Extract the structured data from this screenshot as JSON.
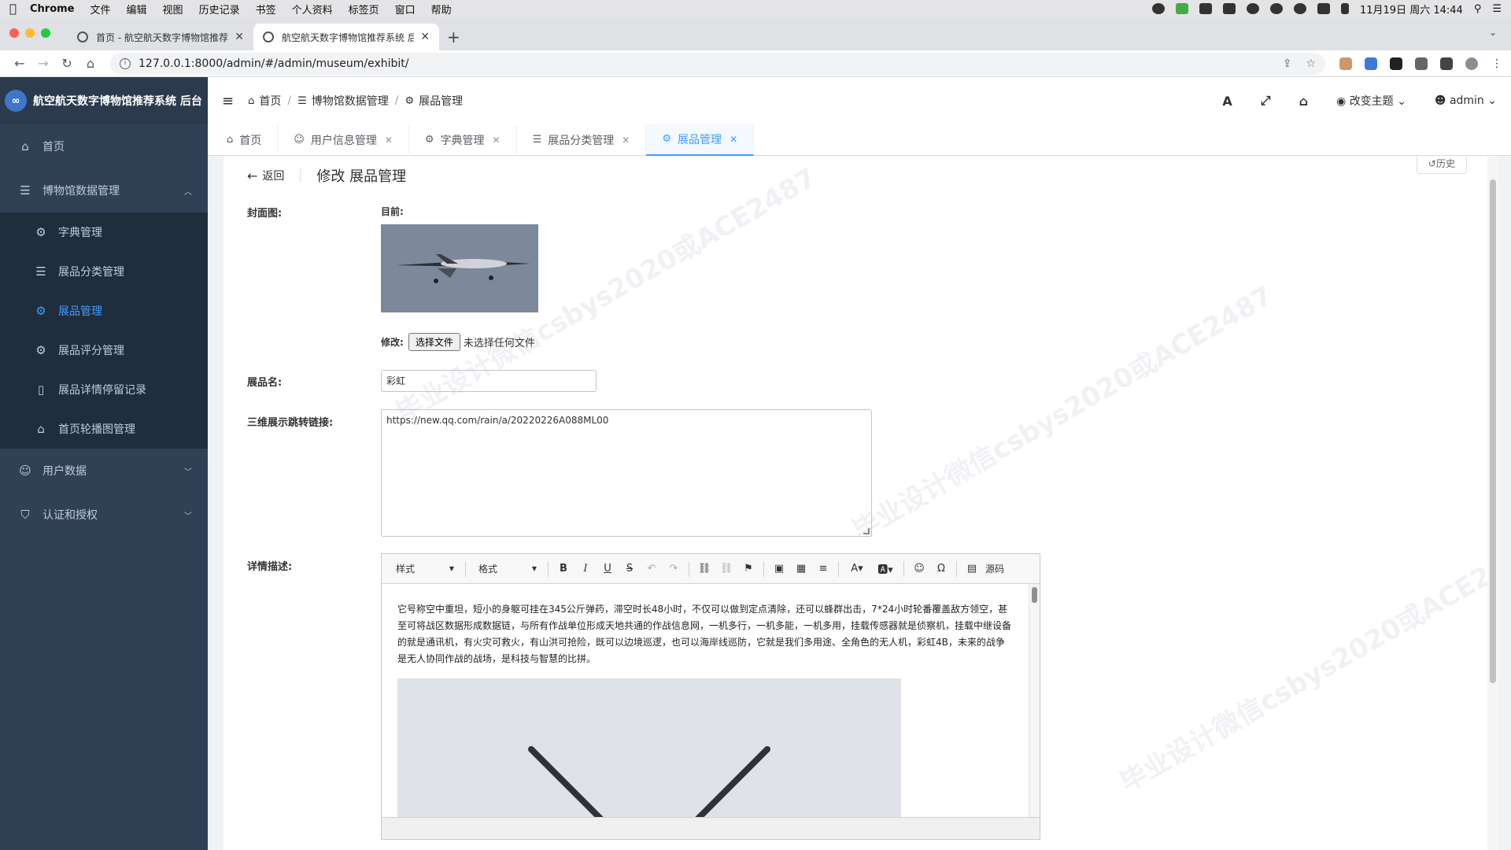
{
  "mac_menu": {
    "app": "Chrome",
    "items": [
      "文件",
      "编辑",
      "视图",
      "历史记录",
      "书签",
      "个人资料",
      "标签页",
      "窗口",
      "帮助"
    ],
    "clock": "11月19日 周六 14:44"
  },
  "browser": {
    "tabs": [
      {
        "title": "首页 - 航空航天数字博物馆推荐系"
      },
      {
        "title": "航空航天数字博物馆推荐系统 后"
      }
    ],
    "url": "127.0.0.1:8000/admin/#/admin/museum/exhibit/"
  },
  "sidebar": {
    "brand": "航空航天数字博物馆推荐系统 后台",
    "logo_glyph": "∞",
    "items": [
      {
        "label": "首页",
        "icon": "home-icon"
      },
      {
        "label": "博物馆数据管理",
        "icon": "database-icon",
        "expanded": true,
        "children": [
          {
            "label": "字典管理",
            "icon": "gear-icon"
          },
          {
            "label": "展品分类管理",
            "icon": "list-icon"
          },
          {
            "label": "展品管理",
            "icon": "gear-icon",
            "active": true
          },
          {
            "label": "展品评分管理",
            "icon": "gear-icon"
          },
          {
            "label": "展品详情停留记录",
            "icon": "bookmark-icon"
          },
          {
            "label": "首页轮播图管理",
            "icon": "home-icon"
          }
        ]
      },
      {
        "label": "用户数据",
        "icon": "user-icon"
      },
      {
        "label": "认证和授权",
        "icon": "shield-icon"
      }
    ]
  },
  "navbar": {
    "breadcrumb": [
      "首页",
      "博物馆数据管理",
      "展品管理"
    ],
    "theme_label": "改变主题",
    "user": "admin",
    "font_glyph": "A"
  },
  "tags": [
    {
      "label": "首页",
      "closable": false
    },
    {
      "label": "用户信息管理",
      "closable": true
    },
    {
      "label": "字典管理",
      "closable": true
    },
    {
      "label": "展品分类管理",
      "closable": true
    },
    {
      "label": "展品管理",
      "closable": true,
      "active": true
    }
  ],
  "page": {
    "back_label": "返回",
    "title": "修改 展品管理",
    "history_label": "历史"
  },
  "form": {
    "cover": {
      "label": "封面图:",
      "current_label": "目前:",
      "change_label": "修改:",
      "file_button": "选择文件",
      "file_status": "未选择任何文件"
    },
    "name": {
      "label": "展品名:",
      "value": "彩虹"
    },
    "link": {
      "label": "三维展示跳转链接:",
      "value": "https://new.qq.com/rain/a/20220226A088ML00"
    },
    "detail": {
      "label": "详情描述:",
      "toolbar": {
        "style_label": "样式",
        "format_label": "格式",
        "source_label": "源码"
      },
      "text": "它号称空中重坦，短小的身躯可挂在345公斤弹药，滞空时长48小时，不仅可以做到定点清除，还可以蜂群出击，7*24小时轮番覆盖敌方领空，甚至可将战区数据形成数据链，与所有作战单位形成天地共通的作战信息网，一机多行，一机多能，一机多用，挂载传感器就是侦察机，挂载中继设备的就是通讯机，有火灾可救火，有山洪可抢险，既可以边境巡逻，也可以海岸线巡防，它就是我们多用途、全角色的无人机，彩虹4B，未来的战争是无人协同作战的战场，是科技与智慧的比拼。"
    }
  },
  "colors": {
    "sidebar_bg": "#304156",
    "accent": "#409eff"
  }
}
